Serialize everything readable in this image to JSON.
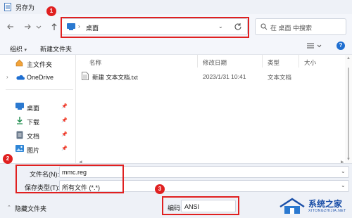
{
  "window": {
    "title": "另存为"
  },
  "nav": {
    "address": "桌面",
    "search_placeholder": "在 桌面 中搜索"
  },
  "toolbar": {
    "organize": "组织",
    "new_folder": "新建文件夹"
  },
  "sidebar": {
    "items": [
      {
        "label": "主文件夹"
      },
      {
        "label": "OneDrive"
      },
      {
        "label": "桌面"
      },
      {
        "label": "下载"
      },
      {
        "label": "文档"
      },
      {
        "label": "图片"
      }
    ]
  },
  "columns": {
    "name": "名称",
    "modified": "修改日期",
    "type": "类型",
    "size": "大小"
  },
  "files": [
    {
      "name": "新建 文本文档.txt",
      "modified": "2023/1/31 10:41",
      "type": "文本文档"
    }
  ],
  "form": {
    "filename_label": "文件名(N):",
    "filename_value": "mmc.reg",
    "filetype_label": "保存类型(T):",
    "filetype_value": "所有文件 (*.*)",
    "encoding_label": "编码:",
    "encoding_value": "ANSI"
  },
  "hide_folders": "隐藏文件夹",
  "annotations": {
    "badge1": "1",
    "badge2": "2",
    "badge3": "3"
  },
  "watermark": {
    "line1": "系统之家",
    "line2": "XITONGZHIJIA.NET"
  },
  "colors": {
    "annotation_red": "#e02020",
    "accent_blue": "#1f6fd1"
  }
}
